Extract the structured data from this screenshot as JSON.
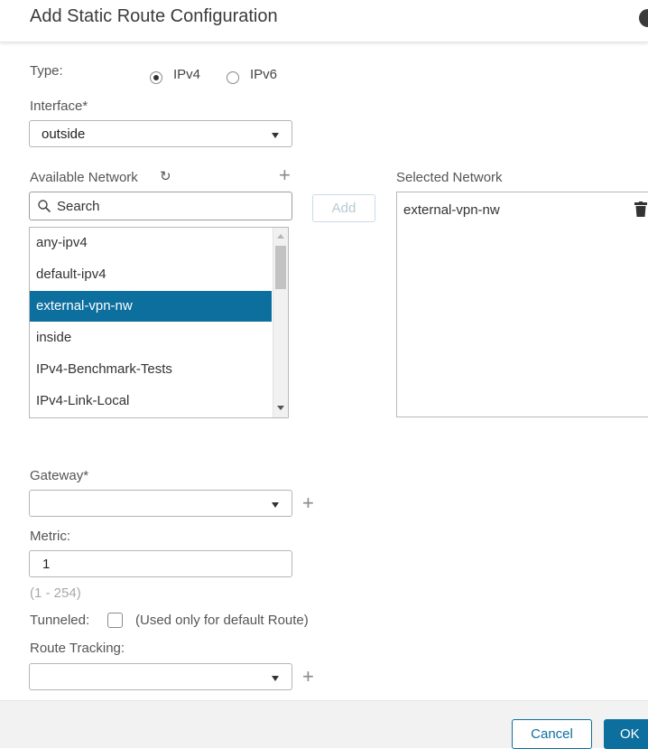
{
  "dialog": {
    "title": "Add Static Route Configuration"
  },
  "type": {
    "label": "Type:",
    "options": [
      "IPv4",
      "IPv6"
    ],
    "selected": "IPv4"
  },
  "interface": {
    "label": "Interface*",
    "value": "outside"
  },
  "available_network": {
    "label": "Available Network",
    "search_placeholder": "Search",
    "items": [
      "any-ipv4",
      "default-ipv4",
      "external-vpn-nw",
      "inside",
      "IPv4-Benchmark-Tests",
      "IPv4-Link-Local"
    ],
    "selected_index": 2
  },
  "add_button": {
    "label": "Add"
  },
  "selected_network": {
    "label": "Selected Network",
    "items": [
      "external-vpn-nw"
    ]
  },
  "gateway": {
    "label": "Gateway*",
    "value": ""
  },
  "metric": {
    "label": "Metric:",
    "value": "1",
    "hint": "(1 - 254)"
  },
  "tunneled": {
    "label": "Tunneled:",
    "checked": false,
    "note": "(Used only for default Route)"
  },
  "route_tracking": {
    "label": "Route Tracking:",
    "value": ""
  },
  "footer": {
    "cancel_label": "Cancel",
    "ok_label": "OK"
  },
  "colors": {
    "accent": "#0d6f9e",
    "footer_bg": "#f2f2f2"
  },
  "icons": {
    "help": "help-icon",
    "refresh": "refresh-icon",
    "search": "search-icon",
    "trash": "trash-icon",
    "add": "plus-icon"
  }
}
